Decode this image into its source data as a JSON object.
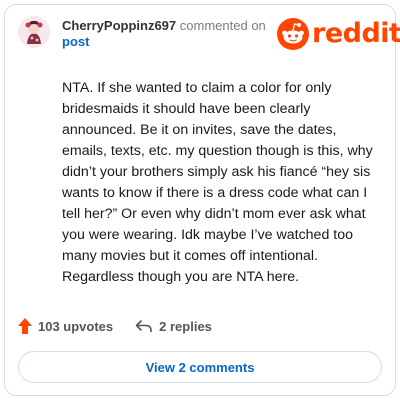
{
  "comment": {
    "username": "CherryPoppinz697",
    "action_text": "commented on",
    "target_link": "post",
    "body": "NTA. If she wanted to claim a color for only bridesmaids it should have been clearly announced. Be it on invites, save the dates, emails, texts, etc. my question though is this, why didn’t your brothers simply ask his fiancé “hey sis wants to know if there is a dress code what can I tell her?” Or even why didn’t mom ever ask what you were wearing. Idk maybe I’ve watched too many movies but it comes off intentional. Regardless though you are NTA here.",
    "upvotes_label": "103 upvotes",
    "replies_label": "2 replies",
    "view_comments_label": "View 2 comments"
  },
  "brand": {
    "wordmark": "reddit",
    "color": "#ff4500"
  },
  "icons": {
    "avatar": "avatar-image",
    "logo": "reddit-snoo-icon",
    "upvote": "upvote-arrow-icon",
    "reply": "reply-arrow-icon"
  },
  "colors": {
    "upvote": "#ff4500",
    "link": "#0a66c2",
    "border": "#d9dce0"
  }
}
